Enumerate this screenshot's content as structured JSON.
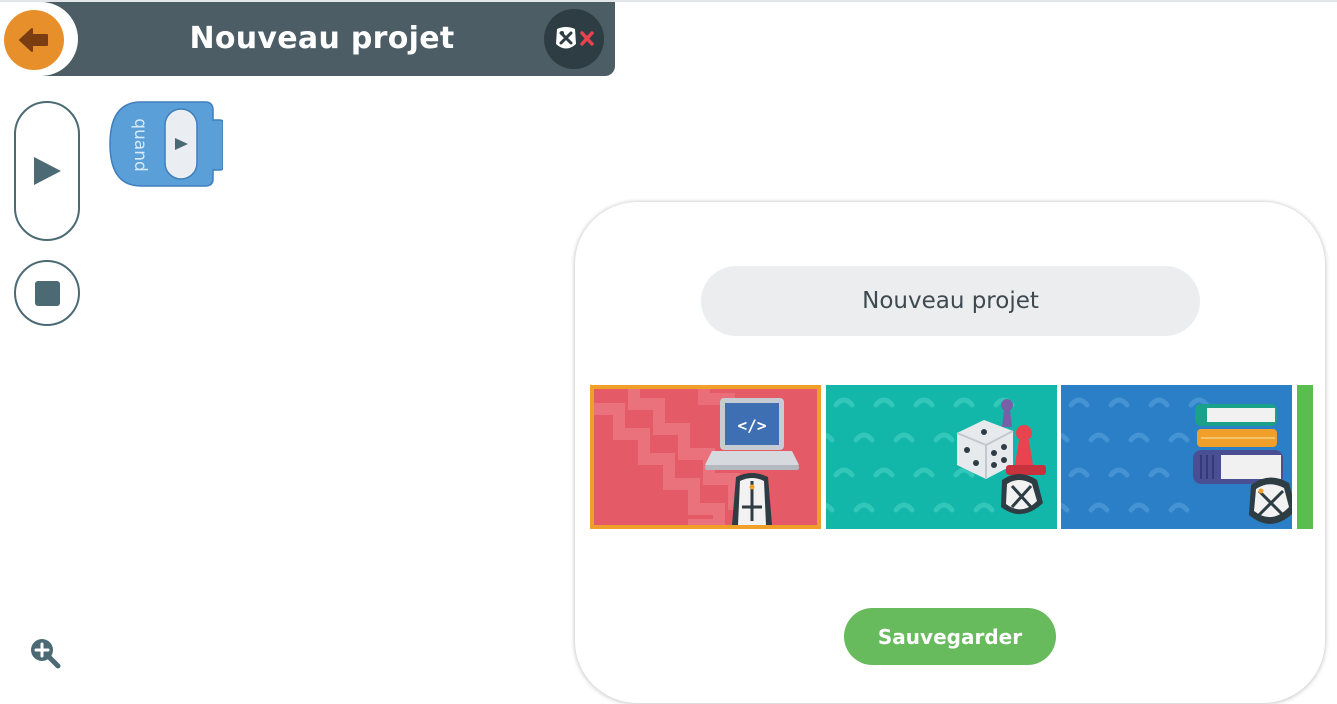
{
  "header": {
    "title": "Nouveau projet",
    "back_icon": "arrow-left-icon",
    "close_robot_icon": "robot-x-icon"
  },
  "toolbar": {
    "run_icon": "play-icon",
    "stop_icon": "stop-icon",
    "zoom_icon": "zoom-in-icon"
  },
  "workspace": {
    "when_block_label": "quand"
  },
  "save_dialog": {
    "project_name_value": "Nouveau projet",
    "save_label": "Sauvegarder",
    "thumbnails": [
      {
        "theme": "laptop",
        "selected": true
      },
      {
        "theme": "games",
        "selected": false
      },
      {
        "theme": "books",
        "selected": false
      },
      {
        "theme": "green",
        "selected": false
      }
    ]
  },
  "colors": {
    "header_bg": "#4c5d65",
    "back_button": "#e78f2b",
    "block_blue": "#5a9fd8",
    "save_green": "#67bb5d",
    "selected_border": "#f0a02a",
    "thumb_red": "#e45a66",
    "thumb_teal": "#13b7a9",
    "thumb_blue": "#2b7fc7",
    "thumb_green": "#5bbd4f"
  }
}
